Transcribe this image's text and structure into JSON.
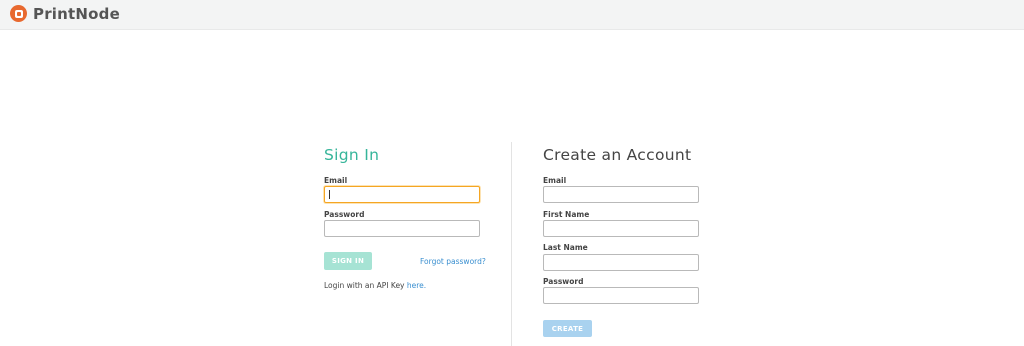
{
  "app": {
    "brand_name": "PrintNode",
    "logo_icon": "printnode-logo-icon",
    "accent_color": "#36b59a",
    "logo_color": "#e8692f"
  },
  "signin": {
    "title": "Sign In",
    "email_label": "Email",
    "email_value": "",
    "password_label": "Password",
    "password_value": "",
    "submit_label": "SIGN IN",
    "forgot_label": "Forgot password?",
    "api_key_text": "Login with an API Key",
    "api_key_link": "here."
  },
  "create": {
    "title": "Create an Account",
    "email_label": "Email",
    "first_name_label": "First Name",
    "last_name_label": "Last Name",
    "password_label": "Password",
    "submit_label": "CREATE"
  }
}
